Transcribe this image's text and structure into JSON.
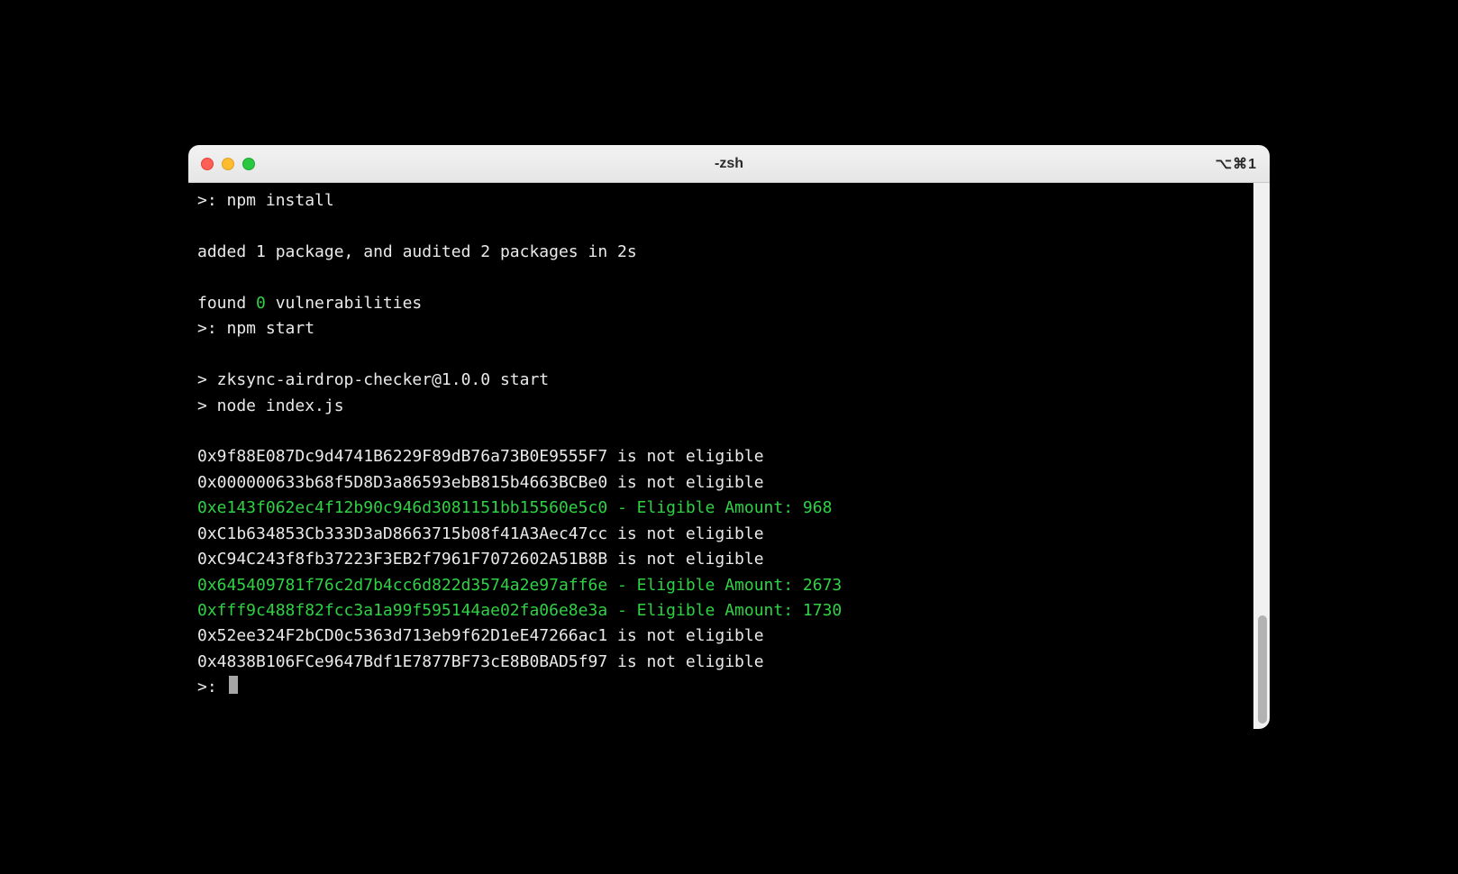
{
  "window": {
    "title": "-zsh",
    "shortcut": "⌥⌘1"
  },
  "lines": [
    {
      "segments": [
        {
          "t": ">: npm install",
          "c": ""
        }
      ]
    },
    {
      "segments": [
        {
          "t": "",
          "c": ""
        }
      ]
    },
    {
      "segments": [
        {
          "t": "added 1 package, and audited 2 packages in 2s",
          "c": ""
        }
      ]
    },
    {
      "segments": [
        {
          "t": "",
          "c": ""
        }
      ]
    },
    {
      "segments": [
        {
          "t": "found ",
          "c": ""
        },
        {
          "t": "0",
          "c": "green"
        },
        {
          "t": " vulnerabilities",
          "c": ""
        }
      ]
    },
    {
      "segments": [
        {
          "t": ">: npm start",
          "c": ""
        }
      ]
    },
    {
      "segments": [
        {
          "t": "",
          "c": ""
        }
      ]
    },
    {
      "segments": [
        {
          "t": "> zksync-airdrop-checker@1.0.0 start",
          "c": ""
        }
      ]
    },
    {
      "segments": [
        {
          "t": "> node index.js",
          "c": ""
        }
      ]
    },
    {
      "segments": [
        {
          "t": "",
          "c": ""
        }
      ]
    },
    {
      "segments": [
        {
          "t": "0x9f88E087Dc9d4741B6229F89dB76a73B0E9555F7 is not eligible",
          "c": ""
        }
      ]
    },
    {
      "segments": [
        {
          "t": "0x000000633b68f5D8D3a86593ebB815b4663BCBe0 is not eligible",
          "c": ""
        }
      ]
    },
    {
      "segments": [
        {
          "t": "0xe143f062ec4f12b90c946d3081151bb15560e5c0 - Eligible Amount: 968",
          "c": "green"
        }
      ]
    },
    {
      "segments": [
        {
          "t": "0xC1b634853Cb333D3aD8663715b08f41A3Aec47cc is not eligible",
          "c": ""
        }
      ]
    },
    {
      "segments": [
        {
          "t": "0xC94C243f8fb37223F3EB2f7961F7072602A51B8B is not eligible",
          "c": ""
        }
      ]
    },
    {
      "segments": [
        {
          "t": "0x645409781f76c2d7b4cc6d822d3574a2e97aff6e - Eligible Amount: 2673",
          "c": "green"
        }
      ]
    },
    {
      "segments": [
        {
          "t": "0xfff9c488f82fcc3a1a99f595144ae02fa06e8e3a - Eligible Amount: 1730",
          "c": "green"
        }
      ]
    },
    {
      "segments": [
        {
          "t": "0x52ee324F2bCD0c5363d713eb9f62D1eE47266ac1 is not eligible",
          "c": ""
        }
      ]
    },
    {
      "segments": [
        {
          "t": "0x4838B106FCe9647Bdf1E7877BF73cE8B0BAD5f97 is not eligible",
          "c": ""
        }
      ]
    }
  ],
  "prompt": ">: "
}
